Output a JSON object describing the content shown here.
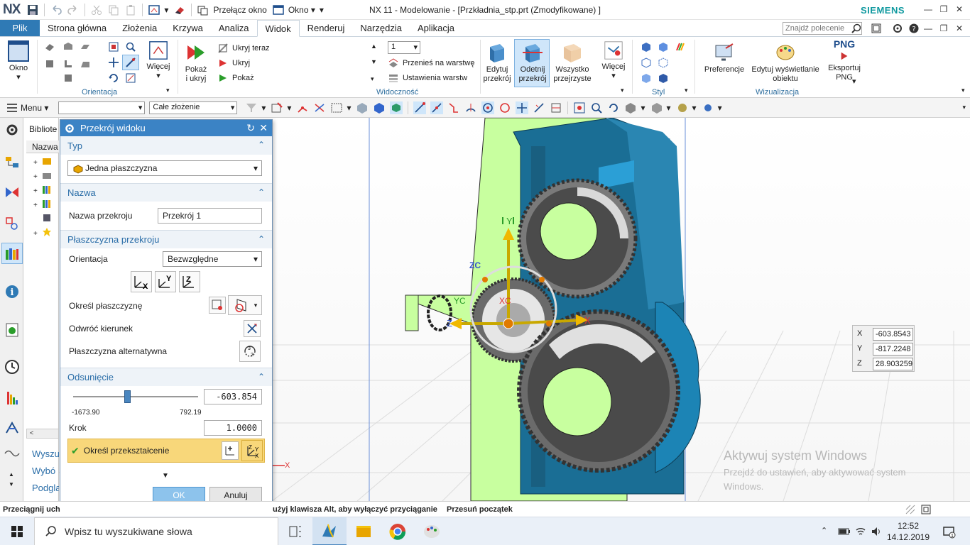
{
  "window": {
    "logo": "NX",
    "title": "NX 11 - Modelowanie - [Przkładnia_stp.prt (Zmodyfikowane) ]",
    "brand": "SIEMENS",
    "switch_window": "Przełącz okno",
    "window_menu": "Okno ▾"
  },
  "tabs": [
    {
      "label": "Plik"
    },
    {
      "label": "Strona główna"
    },
    {
      "label": "Złożenia"
    },
    {
      "label": "Krzywa"
    },
    {
      "label": "Analiza"
    },
    {
      "label": "Widok"
    },
    {
      "label": "Renderuj"
    },
    {
      "label": "Narzędzia"
    },
    {
      "label": "Aplikacja"
    }
  ],
  "find_command_placeholder": "Znajdź polecenie",
  "ribbon": {
    "okno": "Okno",
    "orientacja_group": "Orientacja",
    "wiecej1": "Więcej",
    "pokaz_ukryj": "Pokaż i ukryj",
    "ukryj_teraz": "Ukryj teraz",
    "ukryj": "Ukryj",
    "pokaz": "Pokaż",
    "layer_value": "1",
    "przenies": "Przenieś na warstwę",
    "ustawienia": "Ustawienia warstw",
    "widocznosc_group": "Widoczność",
    "edytuj_przekroj": "Edytuj przekrój",
    "odetnij_przekroj": "Odetnij przekrój",
    "wszystko": "Wszystko przejrzyste",
    "wiecej2": "Więcej",
    "styl_group": "Styl",
    "preferencje": "Preferencje",
    "edytuj_wysw": "Edytuj wyświetlanie obiektu",
    "eksportuj": "Eksportuj PNG",
    "png": "PNG",
    "wizualizacja_group": "Wizualizacja"
  },
  "seltool": {
    "menu": "Menu ▾",
    "filter": "",
    "scope": "Całe złożenie"
  },
  "navigator": {
    "title": "Bibliote",
    "column": "Nazwa",
    "items": [
      "Wyszu",
      "Wybó",
      "Podgla"
    ]
  },
  "dialog": {
    "title": "Przekrój widoku",
    "typ": {
      "header": "Typ",
      "value": "Jedna płaszczyzna"
    },
    "nazwa": {
      "header": "Nazwa",
      "label": "Nazwa przekroju",
      "value": "Przekrój 1"
    },
    "plane": {
      "header": "Płaszczyzna przekroju",
      "orientation_label": "Orientacja",
      "orientation_value": "Bezwzględne",
      "define_plane": "Określ płaszczyznę",
      "reverse": "Odwróć kierunek",
      "alternate": "Płaszczyzna alternatywna"
    },
    "offset": {
      "header": "Odsunięcie",
      "value": "-603.854",
      "min": "-1673.90",
      "max": "792.19",
      "slider_fraction": 0.434,
      "step_label": "Krok",
      "step_value": "1.0000",
      "transform": "Określ przekształcenie"
    },
    "ok": "OK",
    "cancel": "Anuluj"
  },
  "coords": {
    "x_label": "X",
    "x": "-603.8543",
    "y_label": "Y",
    "y": "-817.2248",
    "z_label": "Z",
    "z": "28.903259"
  },
  "axes": {
    "xc": "XC",
    "yc": "YC",
    "zc": "ZC",
    "x": "X",
    "y": "Y",
    "z": "Z"
  },
  "watermark": {
    "line1": "Aktywuj system Windows",
    "line2": "Przejdź do ustawień, aby aktywować system",
    "line3": "Windows."
  },
  "status": {
    "left": "Przeciągnij uch",
    "middle": "użyj klawisza Alt, aby wyłączyć przyciąganie",
    "right": "Przesuń początek"
  },
  "taskbar": {
    "search": "Wpisz tu wyszukiwane słowa",
    "time": "12:52",
    "date": "14.12.2019"
  },
  "colors": {
    "accent": "#3b83c5",
    "plik": "#2f7ab5",
    "section_text": "#2b6ea8",
    "housing": "#c8ff9f",
    "gearbox_blue": "#1a6e95",
    "gear": "#5a5a5a",
    "siemens": "#119aa0"
  }
}
